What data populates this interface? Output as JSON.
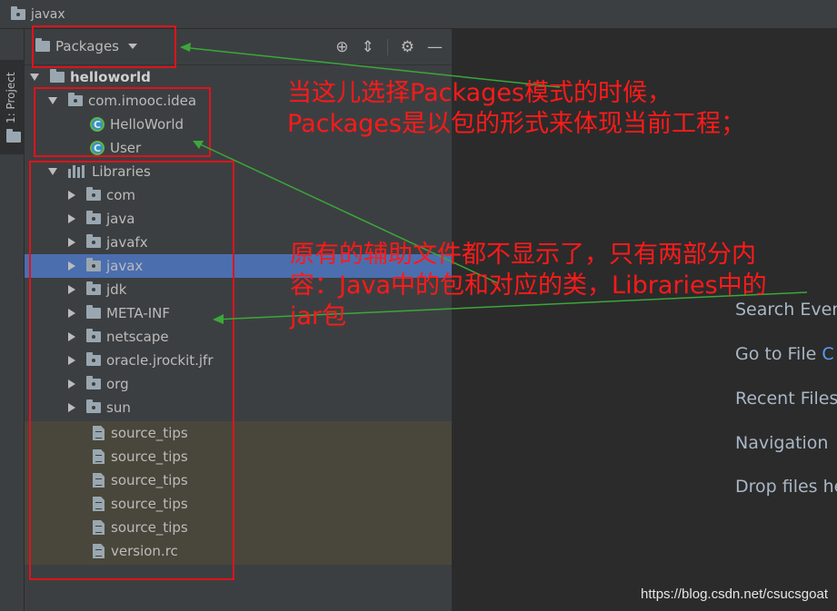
{
  "window": {
    "title": "javax"
  },
  "tool_stripe": {
    "project_tab_label": "1: Project"
  },
  "panel": {
    "view_mode": "Packages",
    "header_icons": [
      "locate-icon",
      "collapse-icon",
      "gear-icon",
      "minimize-icon"
    ]
  },
  "tree": {
    "root": "helloworld",
    "package": "com.imooc.idea",
    "classes": [
      "HelloWorld",
      "User"
    ],
    "libraries": "Libraries",
    "lib_packages": [
      "com",
      "java",
      "javafx",
      "javax",
      "jdk",
      "META-INF",
      "netscape",
      "oracle.jrockit.jfr",
      "org",
      "sun"
    ],
    "selected_package": "javax",
    "files": [
      "source_tips",
      "source_tips",
      "source_tips",
      "source_tips",
      "source_tips",
      "version.rc"
    ],
    "class_badge": "C"
  },
  "editor_hints": [
    "Search Every",
    "Go to File",
    "Recent Files",
    "Navigation",
    "Drop files he"
  ],
  "annotations": {
    "note1_line1": "当这儿选择Packages模式的时候，",
    "note1_line2": "Packages是以包的形式来体现当前工程；",
    "note2_line1": "原有的辅助文件都不显示了，只有两部分内",
    "note2_line2": "容：Java中的包和对应的类，Libraries中的",
    "note2_line3": "jar包"
  },
  "watermark": "https://blog.csdn.net/csucsgoat",
  "colors": {
    "annotation_red": "#ff1a1a",
    "arrow_green": "#3aa83a",
    "selection_blue": "#4b6eaf",
    "nonsource_bg": "#49473b"
  }
}
